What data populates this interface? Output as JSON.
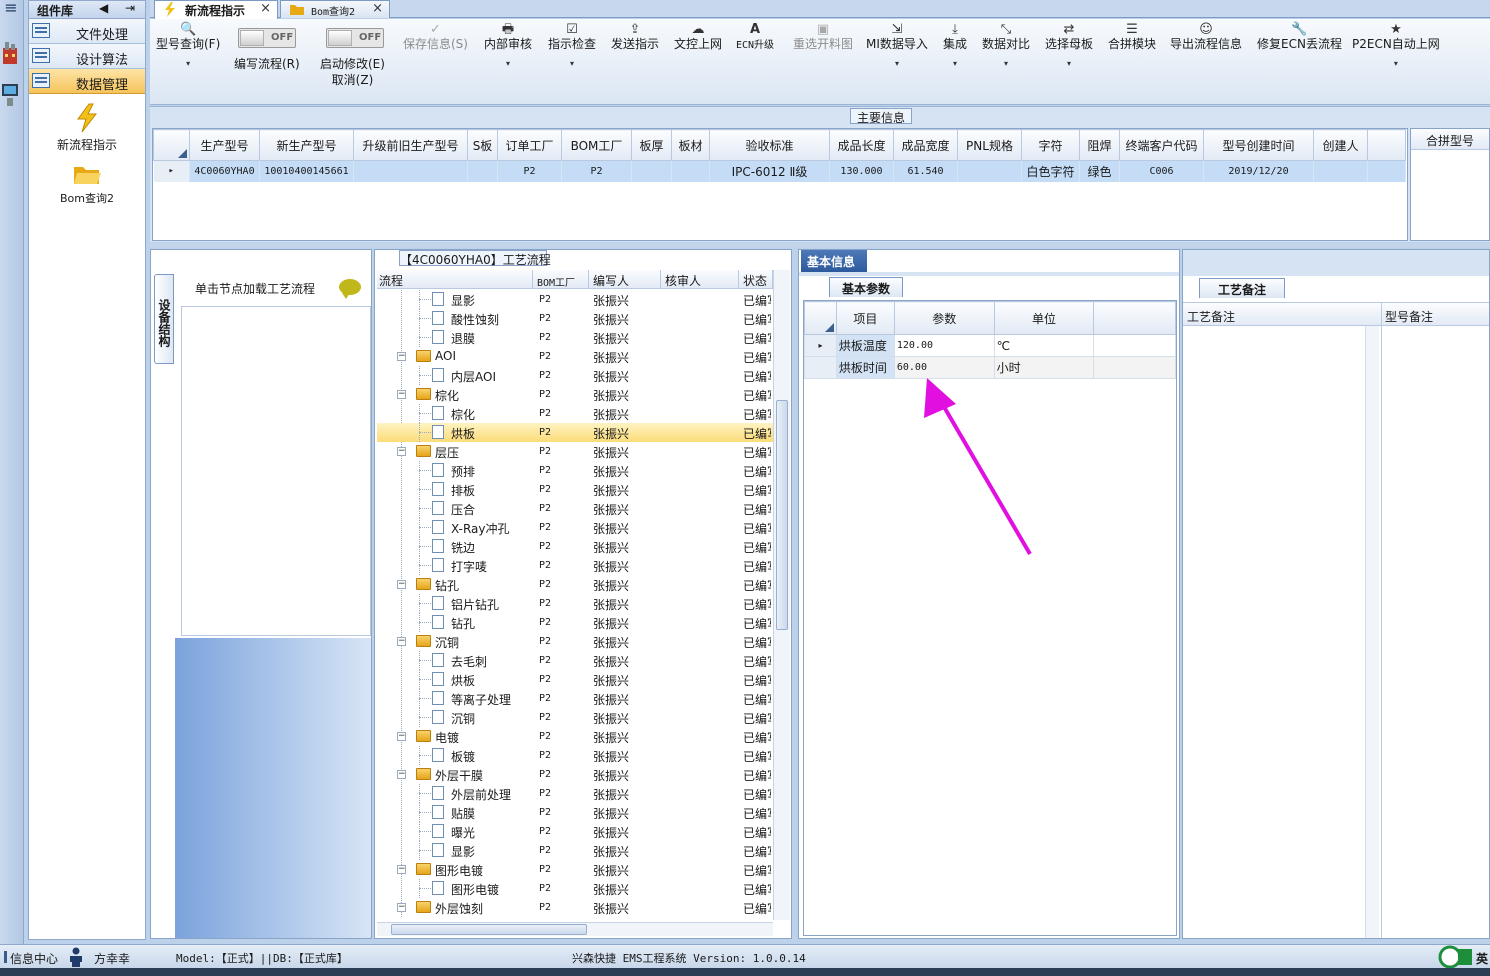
{
  "window": {
    "menu_glyph": "≡",
    "component_library": "组件库",
    "nav_prev_glyph": "◀",
    "nav_next_glyph": "⇥"
  },
  "sidebar": {
    "categories": [
      {
        "label": "文件处理",
        "active": false
      },
      {
        "label": "设计算法",
        "active": false
      },
      {
        "label": "数据管理",
        "active": true
      }
    ],
    "tools": [
      {
        "label": "新流程指示",
        "icon": "lightning-icon"
      },
      {
        "label": "Bom查询2",
        "icon": "folder-open-icon"
      }
    ]
  },
  "tabs": [
    {
      "label": "新流程指示",
      "active": true,
      "close": "×"
    },
    {
      "label": "Bom查询2",
      "active": false,
      "close": "×"
    }
  ],
  "ribbon": {
    "toggle_text": "OFF",
    "buttons": {
      "model_query": {
        "label": "型号查询(F)",
        "glyph": "🔍"
      },
      "write_flow": {
        "label": "编写流程(R)"
      },
      "enable_edit": {
        "label": "启动修改(E)",
        "label2": "取消(Z)"
      },
      "save_info": {
        "label": "保存信息(S)",
        "glyph": "✓"
      },
      "internal_review": {
        "label": "内部审核",
        "glyph": "🖶"
      },
      "instruction_check": {
        "label": "指示检查",
        "glyph": "☑"
      },
      "send_instruction": {
        "label": "发送指示",
        "glyph": "⇪"
      },
      "upload_text": {
        "label": "文控上网",
        "glyph": "☁"
      },
      "ecn_upgrade": {
        "label": "ECN升级",
        "glyph": "A"
      },
      "reselect_material": {
        "label": "重选开料图",
        "glyph": "▣"
      },
      "mi_import": {
        "label": "MI数据导入",
        "glyph": "⇲"
      },
      "integrate": {
        "label": "集成",
        "glyph": "⤓"
      },
      "data_compare": {
        "label": "数据对比",
        "glyph": "⤡"
      },
      "select_master": {
        "label": "选择母板",
        "glyph": "⇄"
      },
      "merge_module": {
        "label": "合拼模块",
        "glyph": "☰"
      },
      "export_flow": {
        "label": "导出流程信息",
        "glyph": "☺"
      },
      "fix_ecn": {
        "label": "修复ECN丢流程",
        "glyph": "🔧"
      },
      "p2ecn": {
        "label": "P2ECN自动上网",
        "glyph": "★"
      }
    },
    "dropdown_glyph": "▾"
  },
  "main_info": {
    "caption": "主要信息",
    "columns": [
      "生产型号",
      "新生产型号",
      "升级前旧生产型号",
      "S板",
      "订单工厂",
      "BOM工厂",
      "板厚",
      "板材",
      "验收标准",
      "成品长度",
      "成品宽度",
      "PNL规格",
      "字符",
      "阻焊",
      "终端客户代码",
      "型号创建时间",
      "创建人"
    ],
    "row_marker": "▸",
    "row": [
      "4C0060YHA0",
      "10010400145661",
      "",
      "",
      "P2",
      "P2",
      "",
      "",
      "IPC-6012 Ⅱ级",
      "130.000",
      "61.540",
      "",
      "白色字符",
      "绿色",
      "C006",
      "2019/12/20",
      ""
    ],
    "merge_header": "合拼型号"
  },
  "device_structure": {
    "tab_label": "设备结构",
    "hint": "单击节点加载工艺流程"
  },
  "process_flow": {
    "title": "【4C0060YHA0】工艺流程",
    "columns": [
      "流程",
      "BOM工厂",
      "编写人",
      "核审人",
      "状态"
    ],
    "expand_glyph": "−",
    "rows": [
      {
        "name": "显影",
        "type": "leaf",
        "bom": "P2",
        "writer": "张振兴",
        "status": "已编写"
      },
      {
        "name": "酸性蚀刻",
        "type": "leaf",
        "bom": "P2",
        "writer": "张振兴",
        "status": "已编写"
      },
      {
        "name": "退膜",
        "type": "leaf",
        "bom": "P2",
        "writer": "张振兴",
        "status": "已编写"
      },
      {
        "name": "AOI",
        "type": "group",
        "bom": "P2",
        "writer": "张振兴",
        "status": "已编写"
      },
      {
        "name": "内层AOI",
        "type": "leaf",
        "bom": "P2",
        "writer": "张振兴",
        "status": "已编写"
      },
      {
        "name": "棕化",
        "type": "group",
        "bom": "P2",
        "writer": "张振兴",
        "status": "已编写"
      },
      {
        "name": "棕化",
        "type": "leaf",
        "bom": "P2",
        "writer": "张振兴",
        "status": "已编写"
      },
      {
        "name": "烘板",
        "type": "leaf",
        "bom": "P2",
        "writer": "张振兴",
        "status": "已编写",
        "selected": true
      },
      {
        "name": "层压",
        "type": "group",
        "bom": "P2",
        "writer": "张振兴",
        "status": "已编写"
      },
      {
        "name": "预排",
        "type": "leaf",
        "bom": "P2",
        "writer": "张振兴",
        "status": "已编写"
      },
      {
        "name": "排板",
        "type": "leaf",
        "bom": "P2",
        "writer": "张振兴",
        "status": "已编写"
      },
      {
        "name": "压合",
        "type": "leaf",
        "bom": "P2",
        "writer": "张振兴",
        "status": "已编写"
      },
      {
        "name": "X-Ray冲孔",
        "type": "leaf",
        "bom": "P2",
        "writer": "张振兴",
        "status": "已编写"
      },
      {
        "name": "铣边",
        "type": "leaf",
        "bom": "P2",
        "writer": "张振兴",
        "status": "已编写"
      },
      {
        "name": "打字唛",
        "type": "leaf",
        "bom": "P2",
        "writer": "张振兴",
        "status": "已编写"
      },
      {
        "name": "钻孔",
        "type": "group",
        "bom": "P2",
        "writer": "张振兴",
        "status": "已编写"
      },
      {
        "name": "铝片钻孔",
        "type": "leaf",
        "bom": "P2",
        "writer": "张振兴",
        "status": "已编写"
      },
      {
        "name": "钻孔",
        "type": "leaf",
        "bom": "P2",
        "writer": "张振兴",
        "status": "已编写"
      },
      {
        "name": "沉铜",
        "type": "group",
        "bom": "P2",
        "writer": "张振兴",
        "status": "已编写"
      },
      {
        "name": "去毛刺",
        "type": "leaf",
        "bom": "P2",
        "writer": "张振兴",
        "status": "已编写"
      },
      {
        "name": "烘板",
        "type": "leaf",
        "bom": "P2",
        "writer": "张振兴",
        "status": "已编写"
      },
      {
        "name": "等离子处理",
        "type": "leaf",
        "bom": "P2",
        "writer": "张振兴",
        "status": "已编写"
      },
      {
        "name": "沉铜",
        "type": "leaf",
        "bom": "P2",
        "writer": "张振兴",
        "status": "已编写"
      },
      {
        "name": "电镀",
        "type": "group",
        "bom": "P2",
        "writer": "张振兴",
        "status": "已编写"
      },
      {
        "name": "板镀",
        "type": "leaf",
        "bom": "P2",
        "writer": "张振兴",
        "status": "已编写"
      },
      {
        "name": "外层干膜",
        "type": "group",
        "bom": "P2",
        "writer": "张振兴",
        "status": "已编写"
      },
      {
        "name": "外层前处理",
        "type": "leaf",
        "bom": "P2",
        "writer": "张振兴",
        "status": "已编写"
      },
      {
        "name": "贴膜",
        "type": "leaf",
        "bom": "P2",
        "writer": "张振兴",
        "status": "已编写"
      },
      {
        "name": "曝光",
        "type": "leaf",
        "bom": "P2",
        "writer": "张振兴",
        "status": "已编写"
      },
      {
        "name": "显影",
        "type": "leaf",
        "bom": "P2",
        "writer": "张振兴",
        "status": "已编写"
      },
      {
        "name": "图形电镀",
        "type": "group",
        "bom": "P2",
        "writer": "张振兴",
        "status": "已编写"
      },
      {
        "name": "图形电镀",
        "type": "leaf",
        "bom": "P2",
        "writer": "张振兴",
        "status": "已编写"
      },
      {
        "name": "外层蚀刻",
        "type": "group",
        "bom": "P2",
        "writer": "张振兴",
        "status": "已编写"
      }
    ]
  },
  "basic_info": {
    "tab": "基本信息",
    "sub_tab": "基本参数",
    "columns": [
      "项目",
      "参数",
      "单位"
    ],
    "row_marker": "▸",
    "rows": [
      {
        "item": "烘板温度",
        "param": "120.00",
        "unit": "℃"
      },
      {
        "item": "烘板时间",
        "param": "60.00",
        "unit": "小时"
      }
    ]
  },
  "process_notes": {
    "tab": "工艺备注",
    "col1": "工艺备注",
    "col2": "型号备注"
  },
  "annotation_color": "#e10fe0",
  "status_bar": {
    "info_center": "信息中心",
    "user": "方幸幸",
    "model_db": "Model:【正式】||DB:【正式库】",
    "system": "兴森快捷 EMS工程系统 Version: 1.0.0.14",
    "ime": "英"
  }
}
